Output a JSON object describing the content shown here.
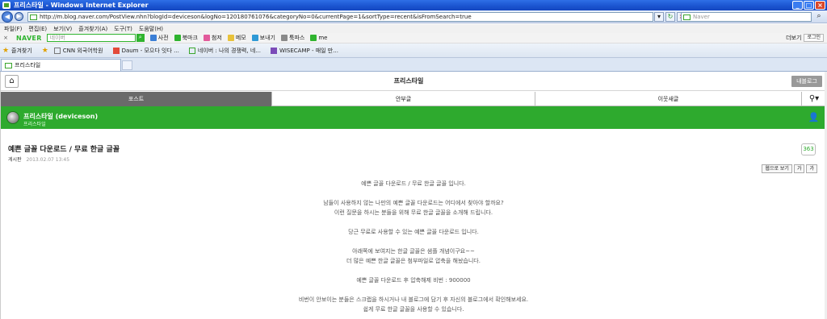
{
  "window": {
    "title": "프리스타일 - Windows Internet Explorer"
  },
  "address": {
    "url": "http://m.blog.naver.com/PostView.nhn?blogId=deviceson&logNo=120180761076&categoryNo=0&currentPage=1&sortType=recent&isFromSearch=true",
    "search_placeholder": "Naver"
  },
  "menu": [
    "파일(F)",
    "편집(E)",
    "보기(V)",
    "즐겨찾기(A)",
    "도구(T)",
    "도움말(H)"
  ],
  "naver_toolbar": {
    "logo": "NAVER",
    "search_placeholder": "네이버",
    "items": [
      "사전",
      "북마크",
      "첨저",
      "메모",
      "보내기",
      "툭파스",
      "me"
    ],
    "right": [
      "더보기",
      "로그인"
    ]
  },
  "favorites": {
    "label": "즐겨찾기",
    "items": [
      "CNN 외국어학원",
      "Daum - 모으다 잇다 ...",
      "네이버 : 나의 경쟁력, 네...",
      "WISECAMP - 매일 만..."
    ]
  },
  "tab": {
    "label": "프리스타일"
  },
  "page": {
    "title": "프리스타일",
    "my_blog_button": "내블로그",
    "tabs": [
      "포스트",
      "안부글",
      "이웃새글"
    ],
    "blog_name": "프리스타일 (deviceson)",
    "blog_sub": "프리스타일",
    "post_title": "예쁜 글꼴 다운로드 / 무료 한글 글꼴",
    "author": "게시판",
    "date": "2013.02.07 13:45",
    "comment_count": "363",
    "view_pc": "웹으로 보기",
    "font_small": "가",
    "font_large": "가",
    "body": [
      "예쁜 글꼴 다운로드 / 무료 한글 글꼴 입니다.",
      "",
      "남들이 사용하지 않는 나만의 예쁜 글꼴 다운로드는 어디에서 찾아야 할까요?",
      "이런 질문을 하시는 분들을 위해 무료 한글 글꼴을 소개해 드립니다.",
      "",
      "당근 무료로 사용할 수 있는 예쁜 글꼴 다운로드 입니다.",
      "",
      "아래쪽에 보여지는 한글 글꼴은 샘플 개념이구요~~",
      "더 많은 예쁜 한글 글꼴은 첨부파일로 압축을 해놨습니다.",
      "",
      "예쁜 글꼴 다운로드 후 압축해제 비번 : 900000",
      "",
      "비번이 안보이는 분들은 스크랩을 하시거나 내 블로그에 담기 후 자신의 블로그에서 확인해보세요.",
      "쉽게 무료 한글 글꼴을 사용할 수 있습니다."
    ]
  }
}
